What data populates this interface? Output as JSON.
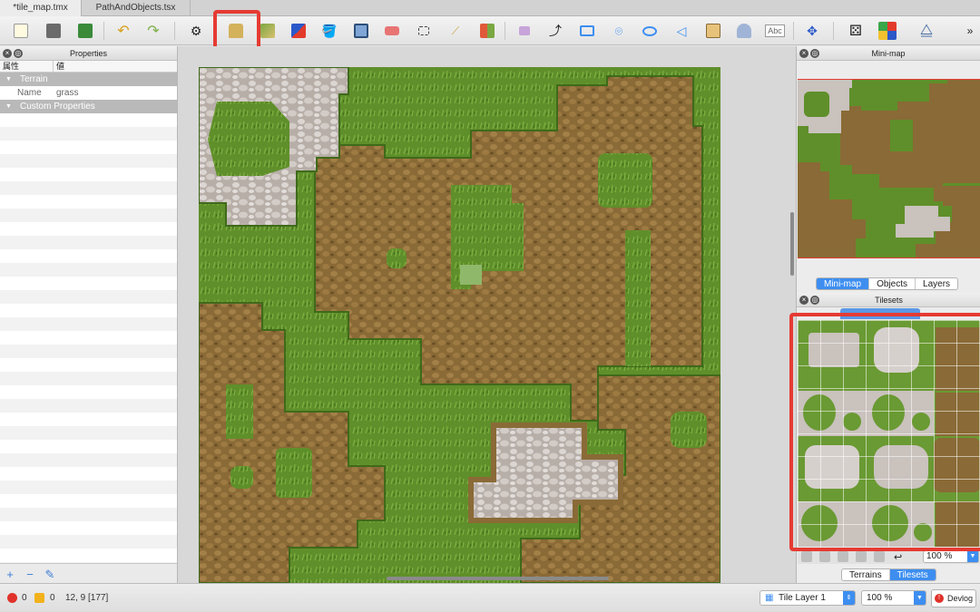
{
  "tabs": [
    {
      "label": "*tile_map.tmx",
      "active": true
    },
    {
      "label": "PathAndObjects.tsx",
      "active": false
    }
  ],
  "toolbar": {
    "icons": [
      "new-file-icon",
      "open-file-icon",
      "save-file-icon",
      "undo-icon",
      "redo-icon",
      "command-icon",
      "stamp-brush-icon",
      "terrain-brush-icon",
      "wang-brush-icon",
      "bucket-fill-icon",
      "shape-fill-icon",
      "eraser-icon",
      "rectangular-select-icon",
      "magic-wand-icon",
      "select-same-tile-icon",
      "select-objects-icon",
      "edit-polygons-icon",
      "insert-rectangle-icon",
      "insert-point-icon",
      "insert-ellipse-icon",
      "insert-polygon-icon",
      "insert-tile-icon",
      "insert-template-icon",
      "insert-text-icon",
      "move-icon",
      "random-mode-icon",
      "wang-fill-icon",
      "flip-icon",
      "overflow-chevron-icon"
    ],
    "text_label": "Abc"
  },
  "properties_panel": {
    "title": "Properties",
    "col_property": "属性",
    "col_value": "値",
    "groups": [
      {
        "label": "Terrain"
      },
      {
        "label": "Custom Properties"
      }
    ],
    "rows": [
      {
        "key": "Name",
        "value": "grass"
      }
    ]
  },
  "minimap_panel": {
    "title": "Mini-map",
    "tabs": [
      {
        "label": "Mini-map",
        "active": true
      },
      {
        "label": "Objects",
        "active": false
      },
      {
        "label": "Layers",
        "active": false
      }
    ]
  },
  "tilesets_panel": {
    "title": "Tilesets",
    "zoom": "100 %",
    "tabs": [
      {
        "label": "Terrains",
        "active": false
      },
      {
        "label": "Tilesets",
        "active": true
      }
    ]
  },
  "statusbar": {
    "errors": "0",
    "warnings": "0",
    "coords": "12, 9 [177]",
    "layer": "Tile Layer 1",
    "zoom": "100 %",
    "devlog": "Devlog"
  },
  "colors": {
    "highlight": "#e53b33",
    "accent": "#3d8ef0",
    "grass": "#5f8f2a",
    "dirt": "#8a6a36",
    "stone": "#c9c2bd"
  }
}
